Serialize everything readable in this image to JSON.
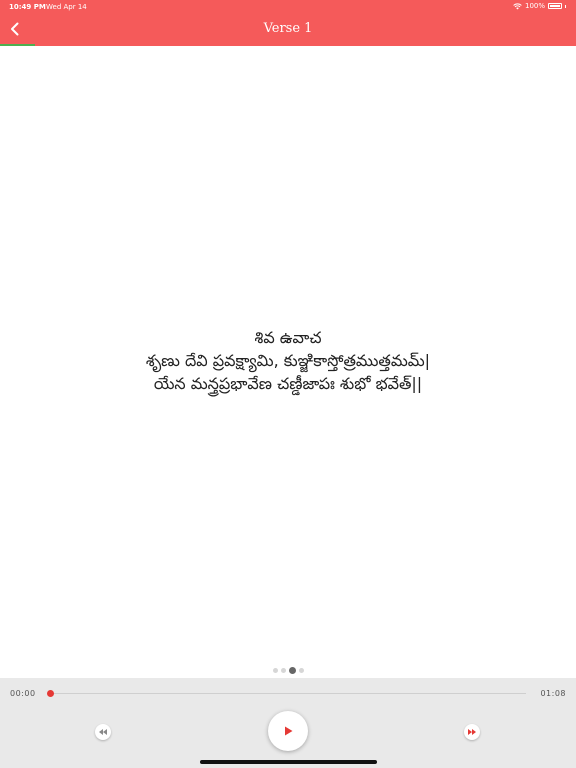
{
  "status_bar": {
    "time": "10:49 PM",
    "date": "Wed Apr 14",
    "battery": "100%"
  },
  "header": {
    "title": "Verse 1",
    "back_icon": "chevron-left-icon",
    "background_color": "#f55a5a",
    "progress": 0.06,
    "progress_color": "#4caf50"
  },
  "verse": {
    "lines": [
      "శివ ఉవాచ",
      "శృణు దేవి ప్రవక్ష్యామి, కుఞ్జికాస్తోత్రముత్తమమ్|",
      "యేన మన్త్రప్రభావేణ చణ్డీజాపః శుభో భవేత్||"
    ]
  },
  "pager": {
    "count": 4,
    "active_index": 2
  },
  "player": {
    "current_time": "00:00",
    "total_time": "01:08",
    "position": 0.0,
    "accent_color": "#e53935",
    "rewind_icon": "rewind-icon",
    "play_icon": "play-icon",
    "forward_icon": "fast-forward-icon"
  }
}
